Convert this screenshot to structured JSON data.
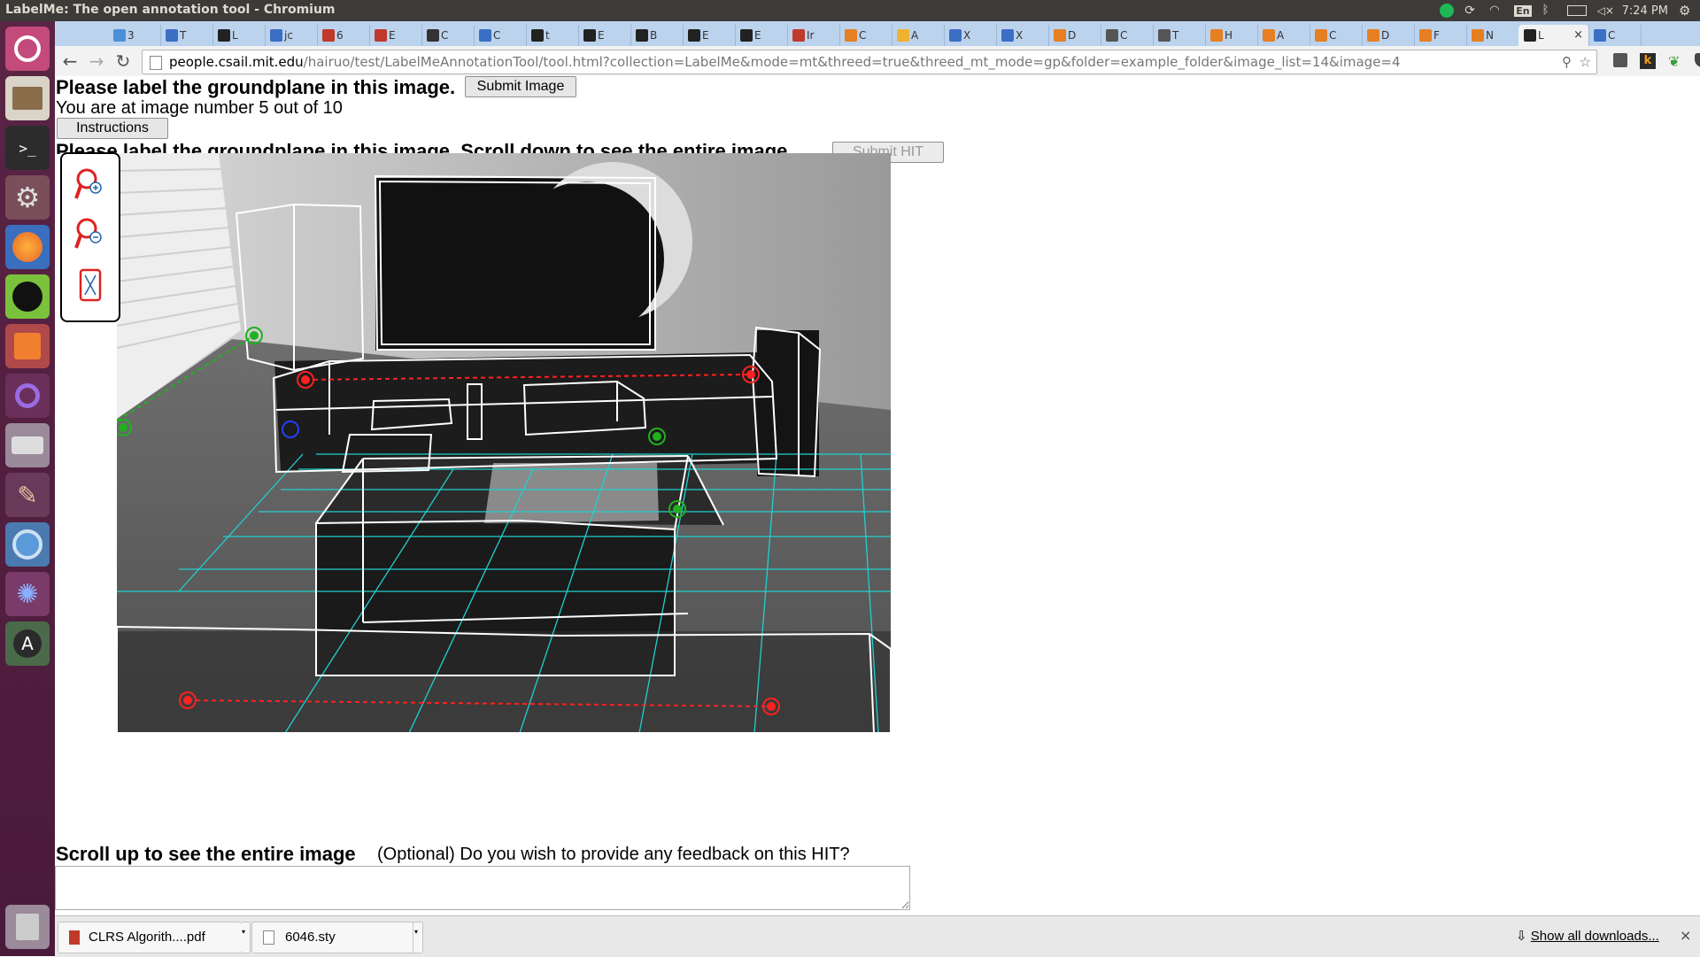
{
  "window": {
    "title": "LabelMe: The open annotation tool - Chromium"
  },
  "tray": {
    "lang": "En",
    "time": "7:24 PM"
  },
  "tabs": [
    {
      "label": "3",
      "color": "#4a90d9"
    },
    {
      "label": "T",
      "color": "#3b6fc4"
    },
    {
      "label": "L",
      "color": "#222222"
    },
    {
      "label": "jc",
      "color": "#3b6fc4"
    },
    {
      "label": "6",
      "color": "#c0392b"
    },
    {
      "label": "E",
      "color": "#c0392b"
    },
    {
      "label": "C",
      "color": "#333333"
    },
    {
      "label": "C",
      "color": "#3b6fc4"
    },
    {
      "label": "t",
      "color": "#222222"
    },
    {
      "label": "E",
      "color": "#222222"
    },
    {
      "label": "B",
      "color": "#222222"
    },
    {
      "label": "E",
      "color": "#222222"
    },
    {
      "label": "E",
      "color": "#222222"
    },
    {
      "label": "Ir",
      "color": "#c0392b"
    },
    {
      "label": "C",
      "color": "#e67e22"
    },
    {
      "label": "A",
      "color": "#f0b030"
    },
    {
      "label": "X",
      "color": "#3b6fc4"
    },
    {
      "label": "X",
      "color": "#3b6fc4"
    },
    {
      "label": "D",
      "color": "#e67e22"
    },
    {
      "label": "C",
      "color": "#555555"
    },
    {
      "label": "T",
      "color": "#555555"
    },
    {
      "label": "H",
      "color": "#e67e22"
    },
    {
      "label": "A",
      "color": "#e67e22"
    },
    {
      "label": "C",
      "color": "#e67e22"
    },
    {
      "label": "D",
      "color": "#e67e22"
    },
    {
      "label": "F",
      "color": "#e67e22"
    },
    {
      "label": "N",
      "color": "#e67e22"
    },
    {
      "label": "L",
      "color": "#222222"
    },
    {
      "label": "C",
      "color": "#3b6fc4"
    }
  ],
  "active_tab_index": 27,
  "address": {
    "host": "people.csail.mit.edu",
    "path": "/hairuo/test/LabelMeAnnotationTool/tool.html?collection=LabelMe&mode=mt&threed=true&threed_mt_mode=gp&folder=example_folder&image_list=14&image=4"
  },
  "page": {
    "heading": "Please label the groundplane in this image.",
    "submit_image": "Submit Image",
    "progress": "You are at image number 5 out of 10",
    "instructions": "Instructions",
    "heading_cut": "Please label the groundplane in this image. Scroll down to see the entire image.",
    "submit_hit": "Submit HIT",
    "scroll_up": "Scroll up to see the entire image",
    "feedback_q": "(Optional) Do you wish to provide any feedback on this HIT?"
  },
  "tools": [
    "zoom-in-icon",
    "zoom-out-icon",
    "fit-to-screen-icon"
  ],
  "downloads": {
    "items": [
      {
        "name": "CLRS Algorith....pdf",
        "icon": "pdf-icon"
      },
      {
        "name": "6046.sty",
        "icon": "document-icon"
      }
    ],
    "show_all": "Show all downloads..."
  }
}
